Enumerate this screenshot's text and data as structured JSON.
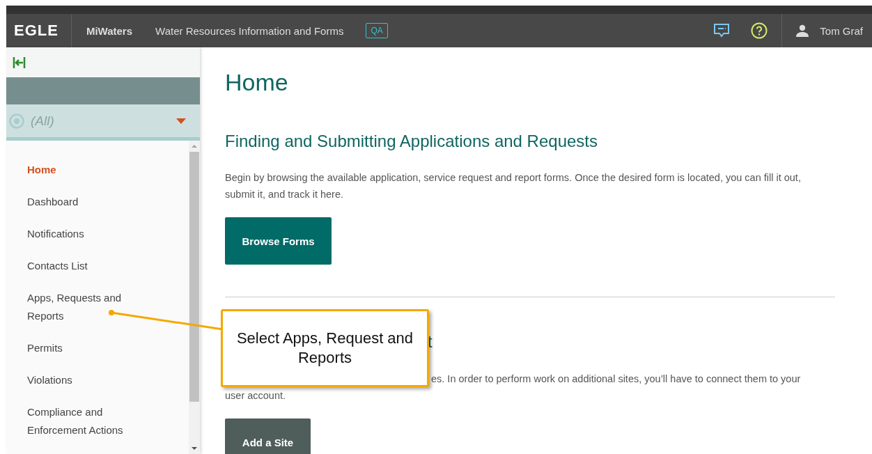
{
  "header": {
    "logo": "EGLE",
    "app_name": "MiWaters",
    "subtitle": "Water Resources Information and Forms",
    "environment_badge": "QA",
    "user_name": "Tom Graf"
  },
  "sidebar": {
    "filter": {
      "value": "(All)"
    },
    "items": [
      {
        "label": "Home",
        "selected": true
      },
      {
        "label": "Dashboard",
        "selected": false
      },
      {
        "label": "Notifications",
        "selected": false
      },
      {
        "label": "Contacts List",
        "selected": false
      },
      {
        "label": "Apps, Requests and Reports",
        "selected": false
      },
      {
        "label": "Permits",
        "selected": false
      },
      {
        "label": "Violations",
        "selected": false
      },
      {
        "label": "Compliance and Enforcement Actions",
        "selected": false
      }
    ]
  },
  "main": {
    "title": "Home",
    "section_1": {
      "heading": "Finding and Submitting Applications and Requests",
      "text": "Begin by browsing the available application, service request and report forms. Once the desired form is located, you can fill it out, submit it, and track it here.",
      "button": "Browse Forms"
    },
    "section_2": {
      "heading_fragment": "t",
      "text_fragment": "es. In order to perform work on additional sites, you’ll have to connect them to your",
      "text_end": "user account.",
      "button": "Add a Site"
    }
  },
  "callout": {
    "text": "Select Apps, Request and Reports"
  }
}
